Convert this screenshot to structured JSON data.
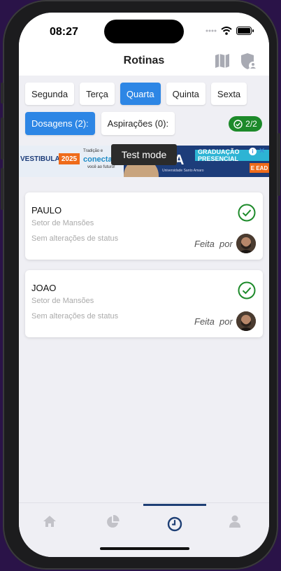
{
  "status_bar": {
    "time": "08:27"
  },
  "header": {
    "title": "Rotinas"
  },
  "days": [
    {
      "label": "Segunda",
      "active": false
    },
    {
      "label": "Terça",
      "active": false
    },
    {
      "label": "Quarta",
      "active": true
    },
    {
      "label": "Quinta",
      "active": false
    },
    {
      "label": "Sexta",
      "active": false
    }
  ],
  "tabs": [
    {
      "label": "Dosagens (2):",
      "active": true
    },
    {
      "label": "Aspirações (0):",
      "active": false
    }
  ],
  "progress": {
    "label": "2/2"
  },
  "ad": {
    "brand_left": "VESTIBULAR",
    "year": "2025",
    "tagline_top": "Tradição e",
    "tagline_main": "conecta",
    "tagline_bottom": "você ao futuro!",
    "logo": "ISA",
    "logo_sub": "Universidade Santo Amaro",
    "right_line1": "GRADUAÇÃO PRESENCIAL",
    "right_line2": "E EAD"
  },
  "test_mode": "Test mode",
  "cards": [
    {
      "name": "PAULO",
      "sector": "Setor de Mansões",
      "status": "Sem alterações de status",
      "done_label": "Feita",
      "by_label": "por"
    },
    {
      "name": "JOAO",
      "sector": "Setor de Mansões",
      "status": "Sem alterações de status",
      "done_label": "Feita",
      "by_label": "por"
    }
  ],
  "colors": {
    "accent": "#2d86e5",
    "success": "#1d8a2a",
    "nav_active": "#1e3f75",
    "nav_inactive": "#c2c2c8"
  },
  "nav": [
    {
      "icon": "home-icon",
      "active": false
    },
    {
      "icon": "pie-chart-icon",
      "active": false
    },
    {
      "icon": "clock-icon",
      "active": true
    },
    {
      "icon": "user-icon",
      "active": false
    }
  ]
}
